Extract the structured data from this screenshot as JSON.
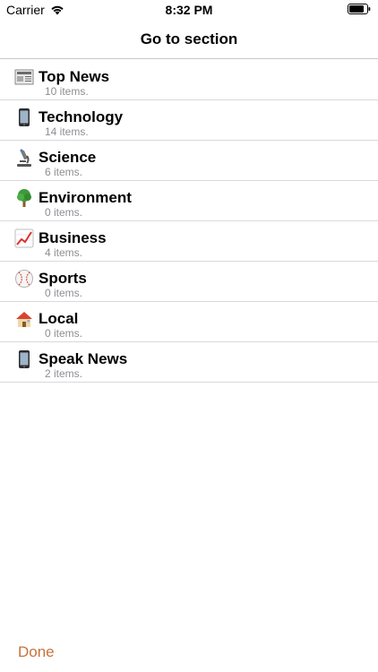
{
  "status_bar": {
    "carrier": "Carrier",
    "time": "8:32 PM"
  },
  "nav": {
    "title": "Go to section"
  },
  "sections": [
    {
      "title": "Top News",
      "count": "10 items.",
      "icon": "newspaper-icon"
    },
    {
      "title": "Technology",
      "count": "14 items.",
      "icon": "mobile-phone-icon"
    },
    {
      "title": "Science",
      "count": "6 items.",
      "icon": "microscope-icon"
    },
    {
      "title": "Environment",
      "count": "0 items.",
      "icon": "tree-icon"
    },
    {
      "title": "Business",
      "count": "4 items.",
      "icon": "chart-increasing-icon"
    },
    {
      "title": "Sports",
      "count": "0 items.",
      "icon": "baseball-icon"
    },
    {
      "title": "Local",
      "count": "0 items.",
      "icon": "house-icon"
    },
    {
      "title": "Speak News",
      "count": "2 items.",
      "icon": "mobile-phone-icon"
    }
  ],
  "footer": {
    "done_label": "Done"
  },
  "colors": {
    "accent": "#c8733a",
    "secondary_text": "#8e8e93",
    "separator": "#d9d9de"
  }
}
